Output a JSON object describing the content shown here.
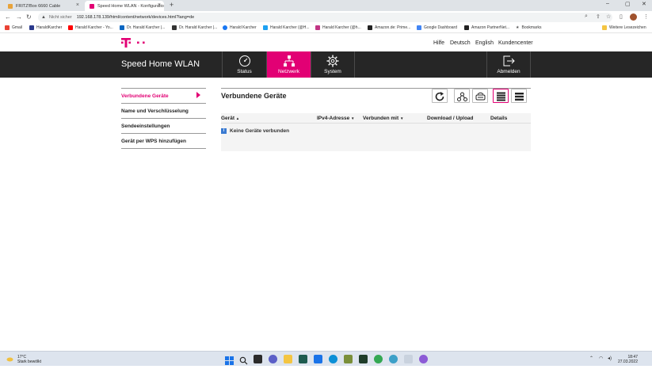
{
  "browser": {
    "tabs": [
      {
        "title": "FRITZ!Box 6660 Cable",
        "active": false,
        "favicon_color": "#e8a33a"
      },
      {
        "title": "Speed Home WLAN - Konfiguratio",
        "active": true,
        "favicon_color": "#e20074"
      }
    ],
    "new_tab_label": "+",
    "window_controls": {
      "minimize": "–",
      "maximize": "▢",
      "close": "✕"
    },
    "address": {
      "security_label": "Nicht sicher",
      "url": "192.168.178.139/html/content/network/devices.html?lang=de"
    },
    "bookmarks": [
      {
        "label": "Gmail",
        "color": "#ea4335"
      },
      {
        "label": "HaraldKarcher",
        "color": "#2b3a8c"
      },
      {
        "label": "Harald Karcher - Yo...",
        "color": "#ff0000"
      },
      {
        "label": "Dr. Harald Karcher |...",
        "color": "#0a66c2"
      },
      {
        "label": "Dr. Harald Karcher |...",
        "color": "#333333"
      },
      {
        "label": "Harald Karcher",
        "color": "#1877f2"
      },
      {
        "label": "Harald Karcher (@H...",
        "color": "#1da1f2"
      },
      {
        "label": "Harald Karcher (@h...",
        "color": "#c13584"
      },
      {
        "label": "Amazon.de: Prime...",
        "color": "#222222"
      },
      {
        "label": "Google Dashboard",
        "color": "#4285f4"
      },
      {
        "label": "Amazon PartnerNet...",
        "color": "#222222"
      },
      {
        "label": "Bookmarks",
        "color": "#555555"
      }
    ],
    "other_bookmarks": "Weitere Lesezeichen"
  },
  "header": {
    "links": [
      "Hilfe",
      "Deutsch",
      "English",
      "Kundencenter"
    ],
    "app_title": "Speed Home WLAN",
    "nav": [
      {
        "label": "Status",
        "icon": "gauge-icon"
      },
      {
        "label": "Netzwerk",
        "icon": "network-icon",
        "active": true
      },
      {
        "label": "System",
        "icon": "gear-icon"
      }
    ],
    "logout_label": "Abmelden",
    "accent_color": "#e20074"
  },
  "sidebar": {
    "items": [
      {
        "label": "Verbundene Geräte",
        "active": true
      },
      {
        "label": "Name und Verschlüsselung"
      },
      {
        "label": "Sendeeinstellungen"
      },
      {
        "label": "Gerät per WPS hinzufügen"
      }
    ]
  },
  "main": {
    "title": "Verbundene Geräte",
    "toolbar_icons": [
      "refresh-icon",
      "topology-icon",
      "router-icon",
      "list-detail-icon",
      "list-compact-icon"
    ],
    "columns": [
      {
        "label": "Gerät",
        "sort": "▲"
      },
      {
        "label": "IPv4-Adresse",
        "sort": "▼"
      },
      {
        "label": "Verbunden mit",
        "sort": "▼"
      },
      {
        "label": "Download / Upload",
        "sort": ""
      },
      {
        "label": "Details",
        "sort": ""
      }
    ],
    "info_icon": "i",
    "empty_message": "Keine Geräte verbunden"
  },
  "taskbar": {
    "weather": {
      "temp": "17°C",
      "condition": "Stark bewölkt"
    },
    "clock": {
      "time": "18:47",
      "date": "27.03.2022"
    }
  }
}
